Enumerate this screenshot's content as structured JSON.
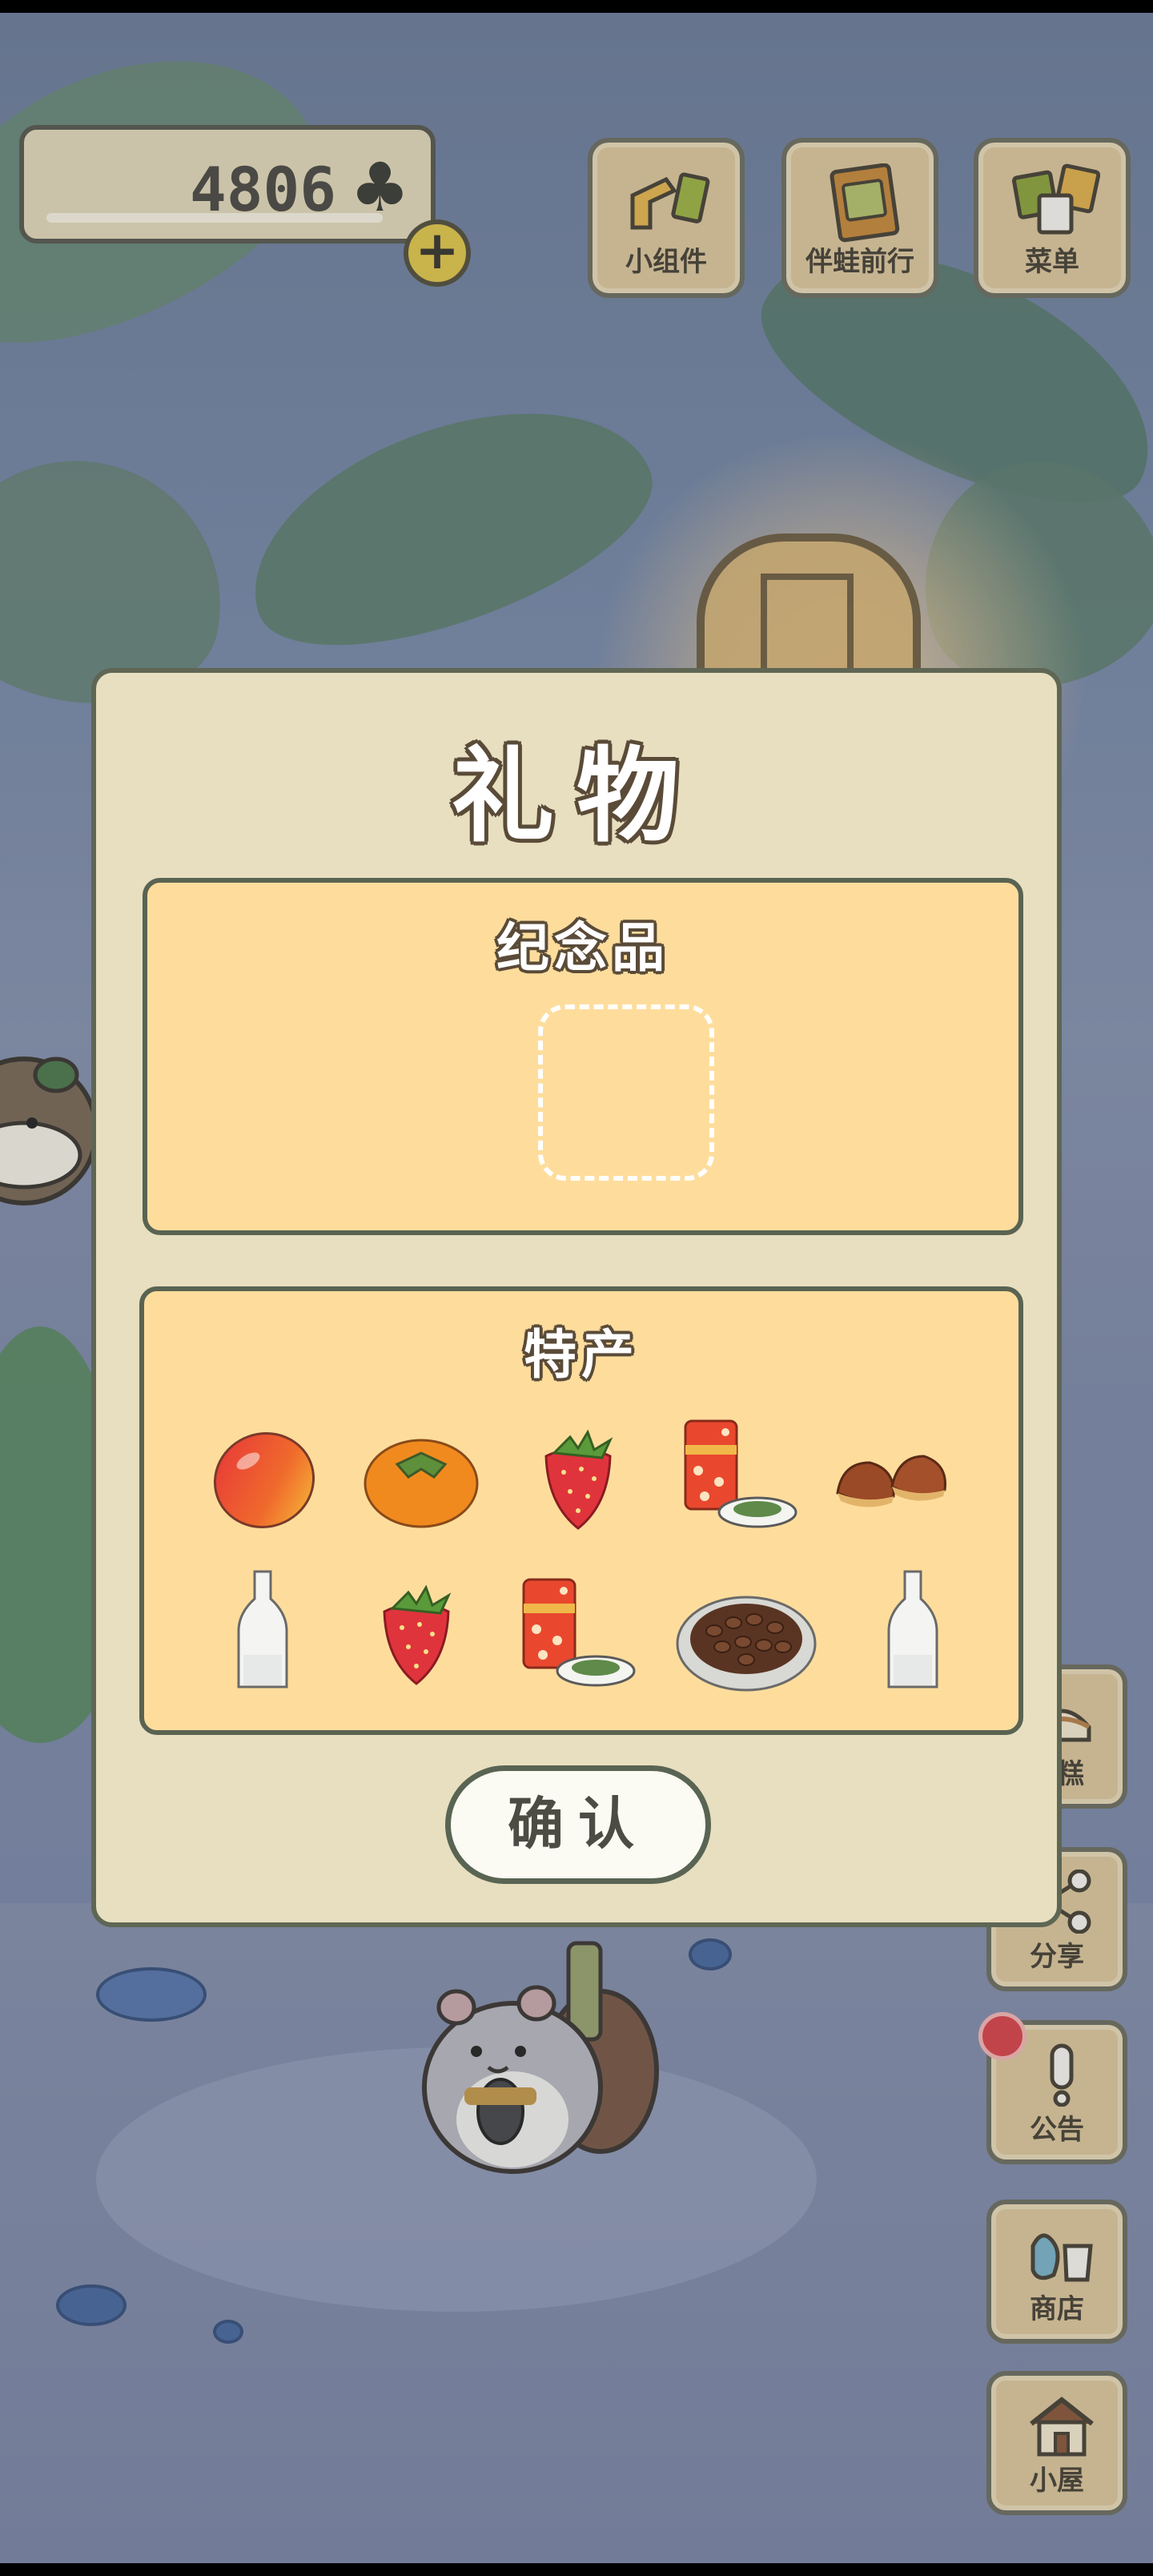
{
  "currency": {
    "amount": "4806",
    "icon": "clover-icon",
    "add_label": "+"
  },
  "top_menu": [
    {
      "label": "小组件",
      "icon": "widget-icon"
    },
    {
      "label": "伴蛙前行",
      "icon": "journey-book-icon"
    },
    {
      "label": "菜单",
      "icon": "menu-cards-icon"
    }
  ],
  "side_menu": [
    {
      "label": "蛋糕",
      "icon": "cake-icon"
    },
    {
      "label": "分享",
      "icon": "share-icon"
    },
    {
      "label": "公告",
      "icon": "notice-icon"
    },
    {
      "label": "商店",
      "icon": "shop-bag-icon"
    },
    {
      "label": "小屋",
      "icon": "house-icon"
    }
  ],
  "dialog": {
    "title": "礼物",
    "souvenir_section": {
      "title": "纪念品",
      "empty": true
    },
    "specialty_section": {
      "title": "特产",
      "items": [
        {
          "name": "mango-icon"
        },
        {
          "name": "persimmon-icon"
        },
        {
          "name": "strawberry-icon"
        },
        {
          "name": "tea-can-icon"
        },
        {
          "name": "chestnut-icon"
        },
        {
          "name": "sake-bottle-icon"
        },
        {
          "name": "strawberry-icon"
        },
        {
          "name": "tea-can-icon"
        },
        {
          "name": "coffee-beans-icon"
        },
        {
          "name": "sake-bottle-icon"
        }
      ]
    },
    "confirm_label": "确认"
  },
  "colors": {
    "dialog_bg": "#e7dfc0",
    "panel_bg": "#fedd9c",
    "border": "#5a6352",
    "button_bg": "#dcc79a"
  }
}
